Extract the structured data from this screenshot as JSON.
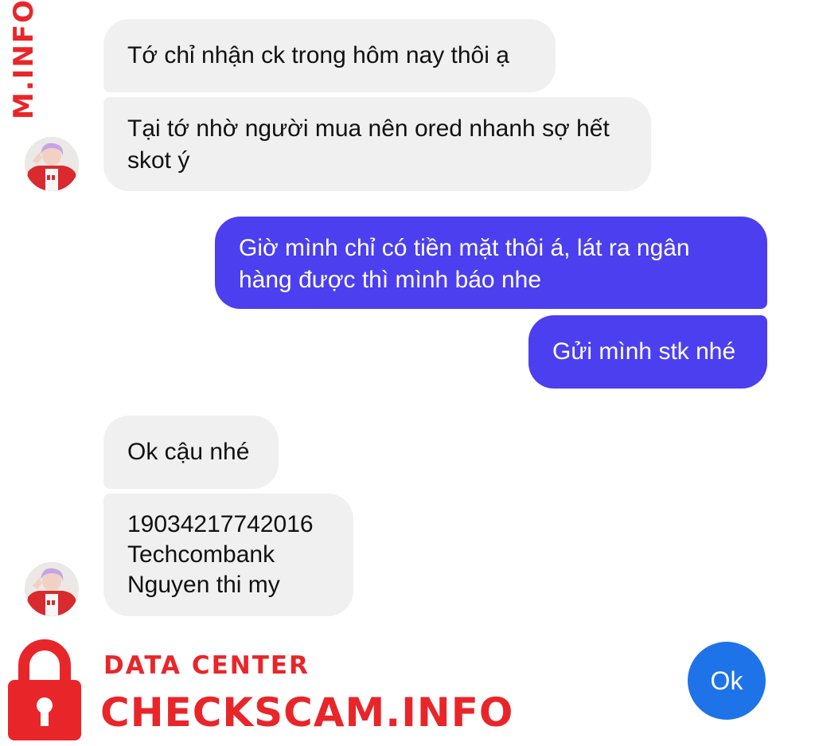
{
  "watermark": {
    "vertical_text": "M.INFO",
    "brand_top": "DATA CENTER",
    "brand_main": "CHECKSCAM.INFO",
    "color": "#e8262a",
    "icon": "padlock-icon"
  },
  "messages": [
    {
      "text": "Tớ chỉ nhận ck trong hôm nay thôi ạ"
    },
    {
      "text": "Tại tớ nhờ người mua nên ored nhanh sợ hết\nskot ý"
    },
    {
      "text": "Giờ mình chỉ có tiền mặt thôi á, lát ra ngân\nhàng được thì mình báo nhe"
    },
    {
      "text": "Gửi mình stk nhé"
    },
    {
      "text": "Ok cậu nhé"
    },
    {
      "text": "19034217742016\nTechcombank\nNguyen thi my"
    }
  ],
  "quick_reply": {
    "label": "Ok"
  },
  "colors": {
    "incoming_bubble": "#f1f0f0",
    "outgoing_bubble": "#4b3ff0",
    "quick_reply": "#1f73e8"
  }
}
